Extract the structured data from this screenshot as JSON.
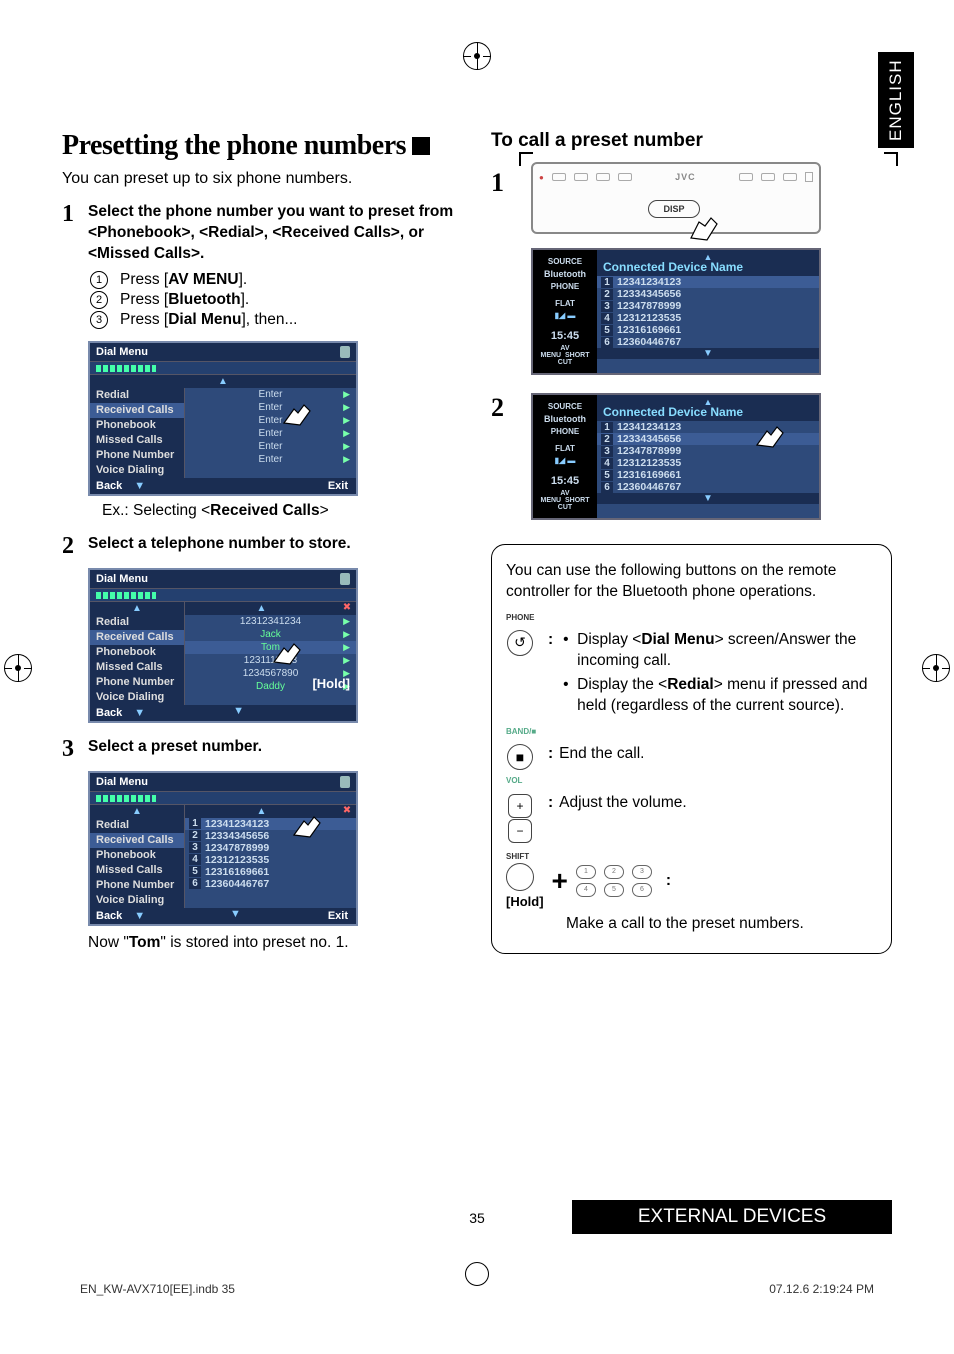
{
  "lang_tab": "ENGLISH",
  "left": {
    "title": "Presetting the phone numbers",
    "intro": "You can preset up to six phone numbers.",
    "step1": {
      "title": "Select the phone number you want to preset from <Phonebook>, <Redial>, <Received Calls>, or <Missed Calls>.",
      "sub1_pre": "Press [",
      "sub1_b": "AV MENU",
      "sub1_post": "].",
      "sub2_pre": "Press [",
      "sub2_b": "Bluetooth",
      "sub2_post": "].",
      "sub3_pre": "Press [",
      "sub3_b": "Dial Menu",
      "sub3_post": "], then..."
    },
    "screen1": {
      "header": "Dial Menu",
      "items": [
        "Redial",
        "Received Calls",
        "Phonebook",
        "Missed Calls",
        "Phone Number",
        "Voice Dialing"
      ],
      "enter": "Enter",
      "back": "Back",
      "exit": "Exit"
    },
    "ex_caption_pre": "Ex.: Selecting <",
    "ex_caption_b": "Received Calls",
    "ex_caption_post": ">",
    "step2": {
      "title": "Select a telephone number to store."
    },
    "screen2": {
      "header": "Dial Menu",
      "right_items": [
        "12312341234",
        "Jack",
        "Tom",
        "1231111223",
        "1234567890",
        "Daddy"
      ],
      "hold": "[Hold]"
    },
    "step3": {
      "title": "Select a preset number."
    },
    "screen3": {
      "presets": [
        "12341234123",
        "12334345656",
        "12347878999",
        "12312123535",
        "12316169661",
        "12360446767"
      ],
      "exit": "Exit"
    },
    "stored_pre": "Now \"",
    "stored_b": "Tom",
    "stored_post": "\" is stored into preset no. 1."
  },
  "right": {
    "title": "To call a preset number",
    "unit": {
      "brand": "JVC",
      "disp": "DISP"
    },
    "sidebar": {
      "source": "SOURCE",
      "bt": "Bluetooth",
      "phone": "PHONE",
      "flat": "FLAT",
      "time": "15:45",
      "av": "AV MENU",
      "short": "SHORT CUT"
    },
    "conn_title": "Connected Device Name",
    "presets": [
      "12341234123",
      "12334345656",
      "12347878999",
      "12312123535",
      "12316169661",
      "12360446767"
    ],
    "info": {
      "intro": "You can use the following buttons on the remote controller for the Bluetooth phone operations.",
      "phone_label": "PHONE",
      "b1a_pre": "Display <",
      "b1a_b": "Dial Menu",
      "b1a_post": "> screen/Answer the incoming call.",
      "b1b_pre": "Display the <",
      "b1b_b": "Redial",
      "b1b_post": "> menu if pressed and held (regardless of the current source).",
      "band_label": "BAND/■",
      "b2": "End the call.",
      "vol_label": "VOL",
      "b3": "Adjust the volume.",
      "shift_label": "SHIFT",
      "hold": "[Hold]",
      "b4": "Make a call to the preset numbers."
    }
  },
  "footer": {
    "page": "35",
    "section": "EXTERNAL DEVICES",
    "file": "EN_KW-AVX710[EE].indb   35",
    "timestamp": "07.12.6   2:19:24 PM"
  }
}
